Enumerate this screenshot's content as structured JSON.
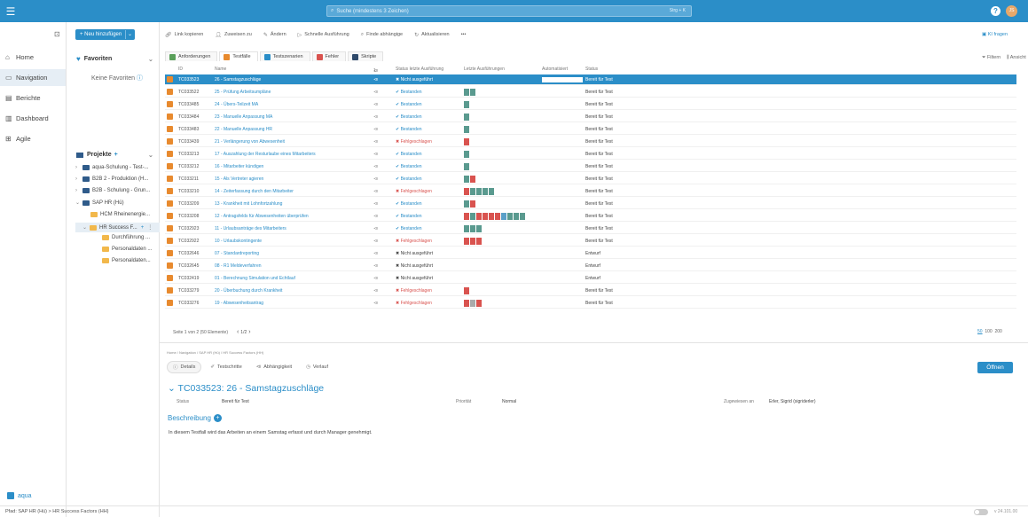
{
  "topbar": {
    "search_placeholder": "Suche (mindestens 3 Zeichen)",
    "search_shortcut": "Strg + K",
    "help": "?",
    "avatar": "JS"
  },
  "leftnav": {
    "items": [
      {
        "label": "Home",
        "icon": "home-icon"
      },
      {
        "label": "Navigation",
        "icon": "book-icon"
      },
      {
        "label": "Berichte",
        "icon": "report-icon"
      },
      {
        "label": "Dashboard",
        "icon": "chart-icon"
      },
      {
        "label": "Agile",
        "icon": "board-icon"
      }
    ],
    "footer_label": "aqua"
  },
  "favorites": {
    "add_button": "+ Neu hinzufügen",
    "title": "Favoriten",
    "empty": "Keine Favoriten"
  },
  "projects": {
    "title": "Projekte",
    "items": [
      {
        "label": "aqua-Schulung - Test-..."
      },
      {
        "label": "B2B 2 - Produktion (H..."
      },
      {
        "label": "B2B - Schulung - Grun..."
      },
      {
        "label": "SAP HR (Hü)"
      },
      {
        "label": "HCM Rheinenergie..."
      },
      {
        "label": "HR Success F..."
      },
      {
        "label": "Durchführung ..."
      },
      {
        "label": "Personaldaten ..."
      },
      {
        "label": "Personaldaten..."
      }
    ]
  },
  "toolbar": {
    "items": [
      "Link kopieren",
      "Zuweisen zu",
      "Ändern",
      "Schnelle Ausführung",
      "Finde abhängige",
      "Aktualisieren",
      "•••"
    ],
    "ki": "KI fragen"
  },
  "tabs": [
    "Anforderungen",
    "Testfälle",
    "Testszenarien",
    "Fehler",
    "Skripte"
  ],
  "filter": "Filtern",
  "ansicht": "Ansicht",
  "table": {
    "headers": {
      "id": "ID",
      "name": "Name",
      "dep": "1",
      "status": "Status letzte Ausführung",
      "runs": "Letzte Ausführungen",
      "auto": "Automatisiert",
      "prog": "Status"
    },
    "rows": [
      {
        "id": "TC033523",
        "name": "26 - Samstagzuschläge",
        "status": "Nicht ausgeführt",
        "type": "none",
        "runs": [],
        "prog": "Bereit für Test",
        "sel": true
      },
      {
        "id": "TC033522",
        "name": "25 - Prüfung Arbeitsumpläne",
        "status": "Bestanden",
        "type": "pass",
        "runs": [
          "#5a9a8f",
          "#5a9a8f"
        ],
        "prog": "Bereit für Test"
      },
      {
        "id": "TC033485",
        "name": "24 - Übers-Teilzeit MA",
        "status": "Bestanden",
        "type": "pass",
        "runs": [
          "#5a9a8f"
        ],
        "prog": "Bereit für Test"
      },
      {
        "id": "TC033484",
        "name": "23 - Manuelle Anpassung MA",
        "status": "Bestanden",
        "type": "pass",
        "runs": [
          "#5a9a8f"
        ],
        "prog": "Bereit für Test"
      },
      {
        "id": "TC033483",
        "name": "22 - Manuelle Anpassung HR",
        "status": "Bestanden",
        "type": "pass",
        "runs": [
          "#5a9a8f"
        ],
        "prog": "Bereit für Test"
      },
      {
        "id": "TC033439",
        "name": "21 - Verlängerung von Abwesenheit",
        "status": "Fehlgeschlagen",
        "type": "fail",
        "runs": [
          "#d9534f"
        ],
        "prog": "Bereit für Test"
      },
      {
        "id": "TC033213",
        "name": "17 - Auszahlung der Resturlaube eines Mitarbeiters",
        "status": "Bestanden",
        "type": "pass",
        "runs": [
          "#5a9a8f"
        ],
        "prog": "Bereit für Test"
      },
      {
        "id": "TC033212",
        "name": "16 - Mitarbeiter kündigen",
        "status": "Bestanden",
        "type": "pass",
        "runs": [
          "#5a9a8f"
        ],
        "prog": "Bereit für Test"
      },
      {
        "id": "TC033211",
        "name": "15 - Als Vertreter agieren",
        "status": "Bestanden",
        "type": "pass",
        "runs": [
          "#5a9a8f",
          "#d9534f"
        ],
        "prog": "Bereit für Test"
      },
      {
        "id": "TC033210",
        "name": "14 - Zeiterfassung durch den Mitarbeiter",
        "status": "Fehlgeschlagen",
        "type": "fail",
        "runs": [
          "#d9534f",
          "#5a9a8f",
          "#5a9a8f",
          "#5a9a8f",
          "#5a9a8f"
        ],
        "prog": "Bereit für Test"
      },
      {
        "id": "TC033209",
        "name": "13 - Krankheit mit Lohnfortzahlung",
        "status": "Bestanden",
        "type": "pass",
        "runs": [
          "#5a9a8f",
          "#d9534f"
        ],
        "prog": "Bereit für Test"
      },
      {
        "id": "TC033208",
        "name": "12 - Antragsfelds für Abwesenheiten überprüfen",
        "status": "Bestanden",
        "type": "pass",
        "runs": [
          "#d9534f",
          "#5a9a8f",
          "#d9534f",
          "#d9534f",
          "#d9534f",
          "#d9534f",
          "#5aa0c8",
          "#5a9a8f",
          "#5a9a8f",
          "#5a9a8f"
        ],
        "prog": "Bereit für Test"
      },
      {
        "id": "TC032923",
        "name": "11 - Urlaubsanträge des Mitarbeiters",
        "status": "Bestanden",
        "type": "pass",
        "runs": [
          "#5a9a8f",
          "#5a9a8f",
          "#5a9a8f"
        ],
        "prog": "Bereit für Test"
      },
      {
        "id": "TC032922",
        "name": "10 - Urlaubskontingente",
        "status": "Fehlgeschlagen",
        "type": "fail",
        "runs": [
          "#d9534f",
          "#d9534f",
          "#d9534f"
        ],
        "prog": "Bereit für Test"
      },
      {
        "id": "TC032646",
        "name": "07 - Standardreporting",
        "status": "Nicht ausgeführt",
        "type": "none",
        "runs": [],
        "prog": "Entwurf"
      },
      {
        "id": "TC032645",
        "name": "08 - R1 Meldeverfahren",
        "status": "Nicht ausgeführt",
        "type": "none",
        "runs": [],
        "prog": "Entwurf"
      },
      {
        "id": "TC032419",
        "name": "01 - Berechnung Simulation und Echtlauf",
        "status": "Nicht ausgeführt",
        "type": "none",
        "runs": [],
        "prog": "Entwurf"
      },
      {
        "id": "TC033279",
        "name": "20 - Überbuchung durch Krankheit",
        "status": "Fehlgeschlagen",
        "type": "fail",
        "runs": [
          "#d9534f"
        ],
        "prog": "Bereit für Test"
      },
      {
        "id": "TC033276",
        "name": "19 - Abwesenheitsantrag",
        "status": "Fehlgeschlagen",
        "type": "fail",
        "runs": [
          "#d9534f",
          "#aaaaaa",
          "#d9534f"
        ],
        "prog": "Bereit für Test"
      }
    ]
  },
  "pager": {
    "text": "Seite 1 von 2 (50 Elemente)",
    "page": "1",
    "total": "2",
    "sizes": [
      "50",
      "100",
      "200"
    ]
  },
  "detail": {
    "crumb": "Home / Navigation / SAP HR (Hü) / HR Success Factors (HH)",
    "tabs": [
      "Details",
      "Testschritte",
      "Abhängigkeit",
      "Verlauf"
    ],
    "open": "Öffnen",
    "title": "TC033523: 26 - Samstagzuschläge",
    "status_label": "Status",
    "status_val": "Bereit für Test",
    "prio_label": "Priorität",
    "prio_val": "Normal",
    "assign_label": "Zugewiesen an",
    "assign_val": "Erler, Sigrid (sigriderler)",
    "desc_title": "Beschreibung",
    "desc": "In diesem Testfall wird das Arbeiten an einem Samstag erfasst und durch Manager genehmigt."
  },
  "footer": {
    "path": "Pfad: SAP HR (Hü) > HR Success Factors (HH)",
    "version": "v 24.101.00"
  },
  "colors": {
    "accent": "#2b8ec8",
    "pass": "#5a9a8f",
    "fail": "#d9534f",
    "folder": "#f2b84b",
    "project": "#2f5b8a"
  }
}
